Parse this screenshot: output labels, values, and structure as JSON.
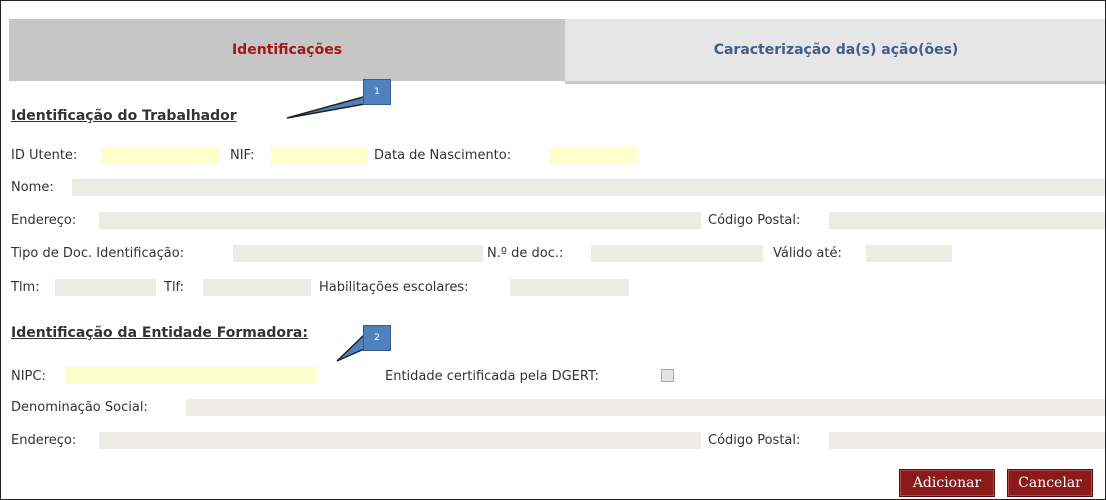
{
  "tabs": {
    "active": "Identificações",
    "inactive": "Caracterização da(s) ação(ões)"
  },
  "worker": {
    "title": "Identificação do Trabalhador",
    "callout": "1",
    "id_utente_label": "ID Utente:",
    "nif_label": "NIF:",
    "birth_label": "Data de Nascimento:",
    "nome_label": "Nome:",
    "endereco_label": "Endereço:",
    "codigo_postal_label": "Código Postal:",
    "doc_type_label": "Tipo de Doc. Identificação:",
    "doc_num_label": "N.º de doc.:",
    "valid_label": "Válido até:",
    "tlm_label": "Tlm:",
    "tlf_label": "Tlf:",
    "habilitacoes_label": "Habilitações escolares:"
  },
  "entity": {
    "title": "Identificação da Entidade Formadora:",
    "callout": "2",
    "nipc_label": "NIPC:",
    "certified_label": "Entidade certificada pela DGERT:",
    "denominacao_label": "Denominação Social:",
    "endereco_label": "Endereço:",
    "codigo_postal_label": "Código Postal:"
  },
  "actions": {
    "add": "Adicionar",
    "cancel": "Cancelar"
  },
  "colors": {
    "active_tab_text": "#a01818",
    "inactive_tab_text": "#3f5e8a",
    "required_field": "#ffffcc",
    "field": "#ecebe6",
    "button": "#8b1a1a",
    "callout": "#4f81bd"
  }
}
